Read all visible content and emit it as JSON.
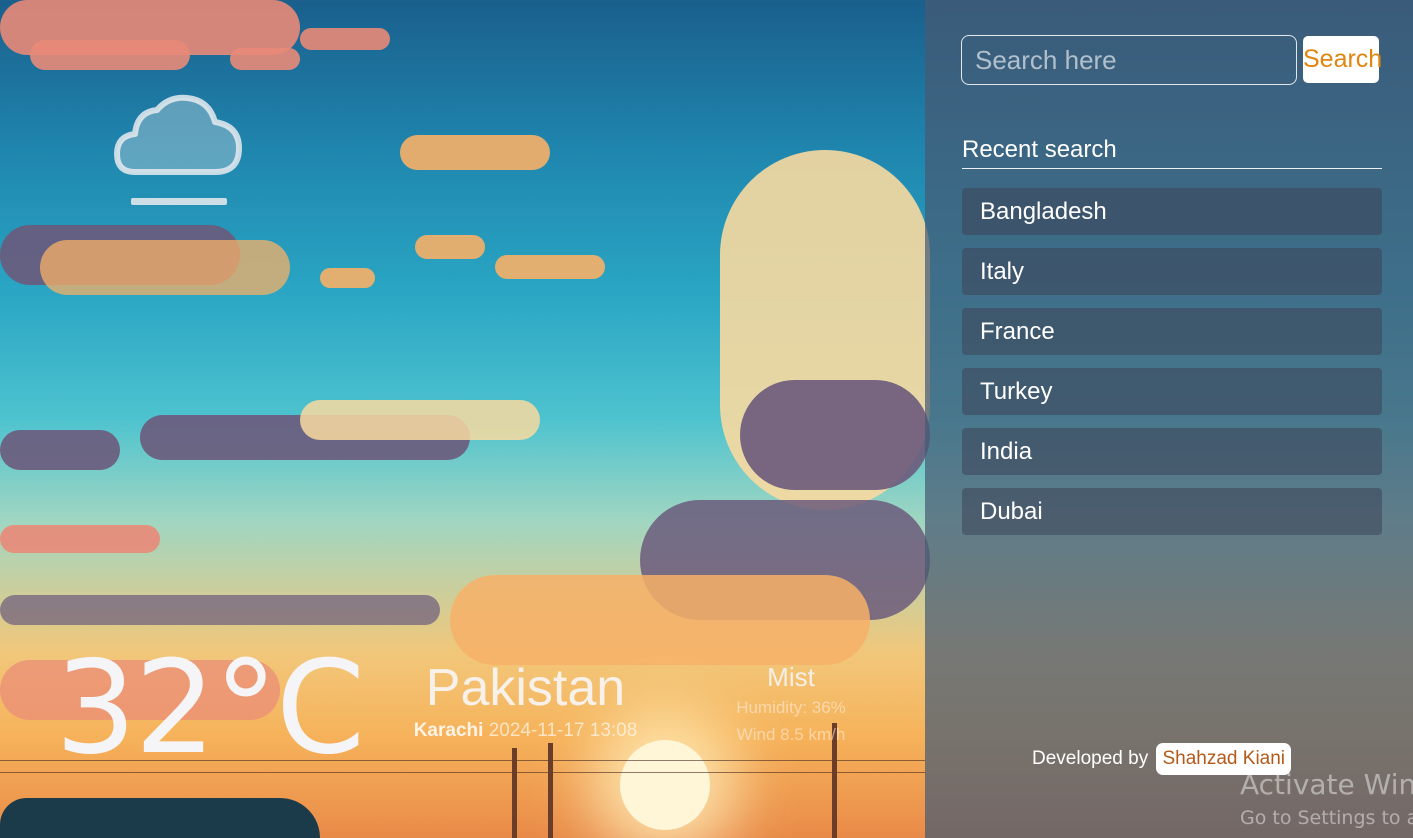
{
  "weather": {
    "icon": "mist-cloud-icon",
    "temperature": "32°C",
    "country": "Pakistan",
    "city": "Karachi",
    "datetime": "2024-11-17 13:08",
    "condition": "Mist",
    "humidity": "Humidity: 36%",
    "wind": "Wind 8.5 km/h"
  },
  "search": {
    "placeholder": "Search here",
    "button_label": "Search"
  },
  "recent": {
    "title": "Recent search",
    "items": [
      "Bangladesh",
      "Italy",
      "France",
      "Turkey",
      "India",
      "Dubai"
    ]
  },
  "footer": {
    "developed_by": "Developed by",
    "developer": "Shahzad Kiani"
  },
  "watermark": {
    "line1": "Activate Windows",
    "line2": "Go to Settings to activate Windows."
  },
  "colors": {
    "accent": "#e0860f",
    "panel": "#465a73"
  }
}
